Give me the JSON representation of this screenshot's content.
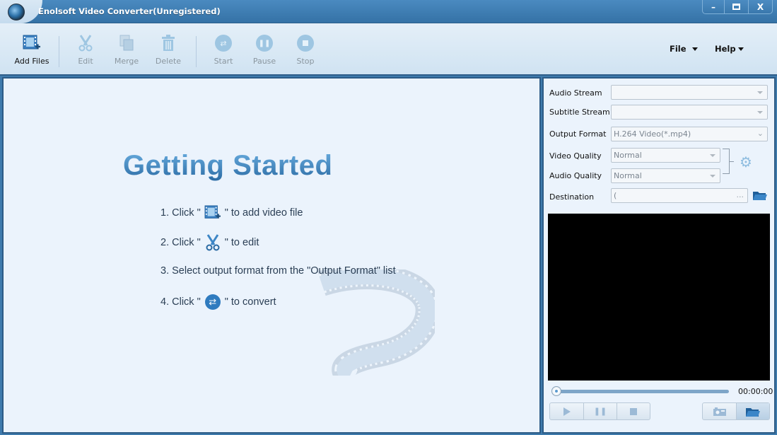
{
  "window": {
    "title": "Enolsoft Video Converter(Unregistered)",
    "controls": {
      "minimize": "–",
      "maximize": "□",
      "close": "X"
    }
  },
  "toolbar": {
    "buttons": [
      {
        "label": "Add Files",
        "icon": "add-files-icon",
        "enabled": true
      },
      {
        "label": "Edit",
        "icon": "scissors-icon",
        "enabled": false
      },
      {
        "label": "Merge",
        "icon": "merge-icon",
        "enabled": false
      },
      {
        "label": "Delete",
        "icon": "trash-icon",
        "enabled": false
      },
      {
        "label": "Start",
        "icon": "convert-icon",
        "enabled": false
      },
      {
        "label": "Pause",
        "icon": "pause-icon",
        "enabled": false
      },
      {
        "label": "Stop",
        "icon": "stop-icon",
        "enabled": false
      }
    ],
    "menus": [
      {
        "label": "File"
      },
      {
        "label": "Help"
      }
    ]
  },
  "getting_started": {
    "title": "Getting Started",
    "steps": [
      {
        "prefix": "1. Click \"",
        "icon": "add-files-icon",
        "suffix": "\" to add video file"
      },
      {
        "prefix": "2. Click \"",
        "icon": "scissors-icon",
        "suffix": "\" to edit"
      },
      {
        "text": "3. Select output format from the \"Output Format\" list"
      },
      {
        "prefix": "4. Click \"",
        "icon": "convert-icon",
        "suffix": "\" to convert"
      }
    ]
  },
  "settings": {
    "audio_stream": {
      "label": "Audio Stream",
      "value": ""
    },
    "subtitle_stream": {
      "label": "Subtitle Stream",
      "value": ""
    },
    "output_format": {
      "label": "Output Format",
      "value": "H.264 Video(*.mp4)"
    },
    "video_quality": {
      "label": "Video Quality",
      "value": "Normal"
    },
    "audio_quality": {
      "label": "Audio Quality",
      "value": "Normal"
    },
    "destination": {
      "label": "Destination",
      "value": "(",
      "browse_label": "..."
    }
  },
  "player": {
    "time": "00:00:00",
    "progress": 0
  },
  "colors": {
    "title_bar": "#3a78ad",
    "accent": "#2a6aa3",
    "pane_bg": "#ebf3fc"
  }
}
